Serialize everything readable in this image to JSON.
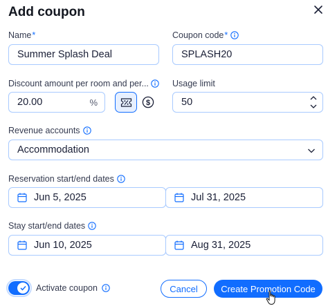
{
  "dialog": {
    "title": "Add coupon"
  },
  "name": {
    "label": "Name",
    "required_mark": "*",
    "value": "Summer Splash Deal"
  },
  "coupon_code": {
    "label": "Coupon code",
    "required_mark": "*",
    "value": "SPLASH20"
  },
  "discount": {
    "label": "Discount amount per room and per...",
    "value": "20.00",
    "unit": "%",
    "selected_type": "percentage"
  },
  "usage_limit": {
    "label": "Usage limit",
    "value": "50"
  },
  "revenue_accounts": {
    "label": "Revenue accounts",
    "selected": "Accommodation"
  },
  "reservation_dates": {
    "label": "Reservation start/end dates",
    "start": "Jun 5, 2025",
    "end": "Jul 31, 2025"
  },
  "stay_dates": {
    "label": "Stay start/end dates",
    "start": "Jun 10, 2025",
    "end": "Aug 31, 2025"
  },
  "activate": {
    "label": "Activate coupon",
    "on": true
  },
  "actions": {
    "cancel_label": "Cancel",
    "create_label": "Create Promotion Code"
  },
  "colors": {
    "accent": "#116dff",
    "field_border": "#a8caff",
    "text": "#1a1f36"
  }
}
